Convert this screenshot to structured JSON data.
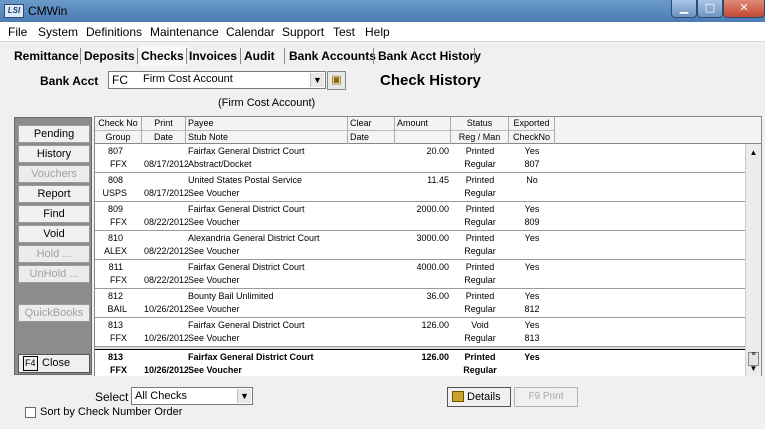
{
  "window": {
    "title": "CMWin",
    "icon_text": "LSI",
    "min": "▁",
    "max": "□",
    "close": "✕"
  },
  "menu": [
    "File",
    "System",
    "Definitions",
    "Maintenance",
    "Calendar",
    "Support",
    "Test",
    "Help"
  ],
  "tabs": [
    "Remittance",
    "Deposits",
    "Checks",
    "Invoices",
    "Audit",
    "Bank Accounts",
    "Bank Acct History"
  ],
  "active_tab": "Checks",
  "bank": {
    "label": "Bank Acct",
    "code": "FC",
    "name": "Firm Cost Account",
    "sub": "(Firm Cost Account)"
  },
  "page_title": "Check History",
  "side_buttons": [
    {
      "label": "Pending",
      "enabled": true
    },
    {
      "label": "History",
      "enabled": true
    },
    {
      "label": "Vouchers",
      "enabled": false
    },
    {
      "label": "Report",
      "enabled": true
    },
    {
      "label": "Find",
      "enabled": true
    },
    {
      "label": "Void",
      "enabled": true
    },
    {
      "label": "Hold ...",
      "enabled": false
    },
    {
      "label": "UnHold ...",
      "enabled": false
    },
    {
      "label": "QuickBooks",
      "enabled": false
    }
  ],
  "close": {
    "key": "F4",
    "label": "Close"
  },
  "grid": {
    "headers_top": [
      "Check No",
      "Print",
      "Payee",
      "Clear",
      "Amount",
      "Status",
      "Exported"
    ],
    "headers_bottom": [
      "Group",
      "Date",
      "Stub Note",
      "Date",
      "",
      "Reg / Man",
      "CheckNo"
    ],
    "rows": [
      {
        "check_no": "807",
        "group": "FFX",
        "print_date": "08/17/2012",
        "payee": "Fairfax General District Court",
        "stub": "Abstract/Docket",
        "clear": "",
        "amount": "20.00",
        "status": "Printed",
        "reg": "Regular",
        "exported": "Yes",
        "exp_no": "807"
      },
      {
        "check_no": "808",
        "group": "USPS",
        "print_date": "08/17/2012",
        "payee": "United States Postal Service",
        "stub": "See Voucher",
        "clear": "",
        "amount": "11.45",
        "status": "Printed",
        "reg": "Regular",
        "exported": "No",
        "exp_no": ""
      },
      {
        "check_no": "809",
        "group": "FFX",
        "print_date": "08/22/2012",
        "payee": "Fairfax General District Court",
        "stub": "See Voucher",
        "clear": "",
        "amount": "2000.00",
        "status": "Printed",
        "reg": "Regular",
        "exported": "Yes",
        "exp_no": "809"
      },
      {
        "check_no": "810",
        "group": "ALEX",
        "print_date": "08/22/2012",
        "payee": "Alexandria General District Court",
        "stub": "See Voucher",
        "clear": "",
        "amount": "3000.00",
        "status": "Printed",
        "reg": "Regular",
        "exported": "Yes",
        "exp_no": ""
      },
      {
        "check_no": "811",
        "group": "FFX",
        "print_date": "08/22/2012",
        "payee": "Fairfax General District Court",
        "stub": "See Voucher",
        "clear": "",
        "amount": "4000.00",
        "status": "Printed",
        "reg": "Regular",
        "exported": "Yes",
        "exp_no": ""
      },
      {
        "check_no": "812",
        "group": "BAIL",
        "print_date": "10/26/2012",
        "payee": "Bounty Bail Unlimited",
        "stub": "See Voucher",
        "clear": "",
        "amount": "36.00",
        "status": "Printed",
        "reg": "Regular",
        "exported": "Yes",
        "exp_no": "812"
      },
      {
        "check_no": "813",
        "group": "FFX",
        "print_date": "10/26/2012",
        "payee": "Fairfax General District Court",
        "stub": "See Voucher",
        "clear": "",
        "amount": "126.00",
        "status": "Void",
        "reg": "Regular",
        "exported": "Yes",
        "exp_no": "813"
      },
      {
        "check_no": "813",
        "group": "FFX",
        "print_date": "10/26/2012",
        "payee": "Fairfax General District Court",
        "stub": "See Voucher",
        "clear": "",
        "amount": "126.00",
        "status": "Printed",
        "reg": "Regular",
        "exported": "Yes",
        "exp_no": ""
      }
    ],
    "selected_row": 7
  },
  "select": {
    "label": "Select",
    "value": "All Checks"
  },
  "details_label": "Details",
  "print_label": "F9  Print",
  "sort_label": "Sort by Check Number Order",
  "sort_checked": false
}
